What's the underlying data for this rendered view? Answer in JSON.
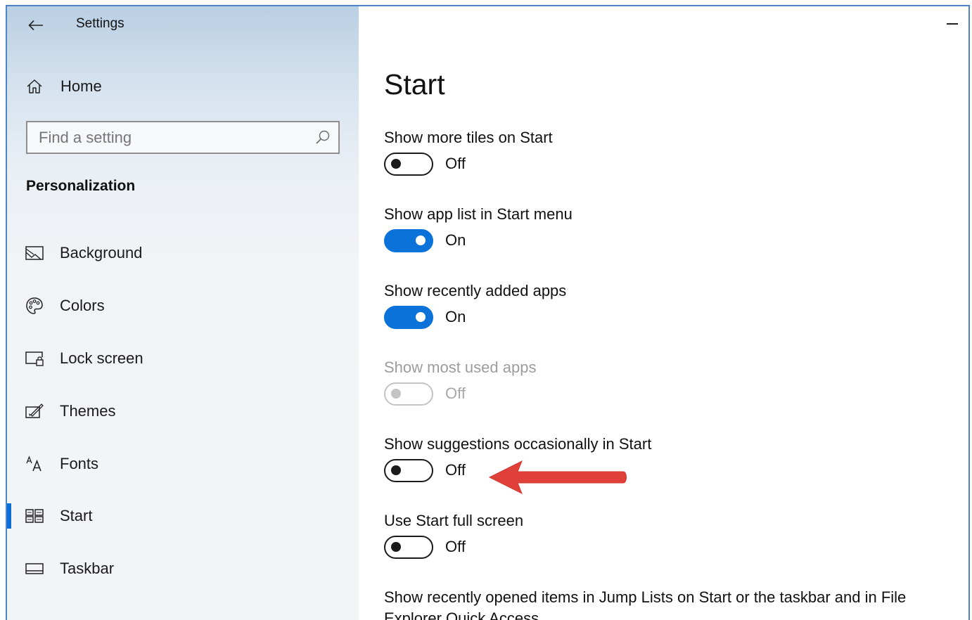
{
  "window": {
    "app_title": "Settings"
  },
  "sidebar": {
    "home_label": "Home",
    "search": {
      "placeholder": "Find a setting",
      "value": ""
    },
    "section_header": "Personalization",
    "items": [
      {
        "label": "Background",
        "icon": "image-icon",
        "selected": false
      },
      {
        "label": "Colors",
        "icon": "palette-icon",
        "selected": false
      },
      {
        "label": "Lock screen",
        "icon": "lock-screen-icon",
        "selected": false
      },
      {
        "label": "Themes",
        "icon": "themes-icon",
        "selected": false
      },
      {
        "label": "Fonts",
        "icon": "fonts-icon",
        "selected": false
      },
      {
        "label": "Start",
        "icon": "start-tiles-icon",
        "selected": true
      },
      {
        "label": "Taskbar",
        "icon": "taskbar-icon",
        "selected": false
      }
    ]
  },
  "main": {
    "title": "Start",
    "settings": [
      {
        "label": "Show more tiles on Start",
        "state": "Off",
        "on": false,
        "disabled": false
      },
      {
        "label": "Show app list in Start menu",
        "state": "On",
        "on": true,
        "disabled": false
      },
      {
        "label": "Show recently added apps",
        "state": "On",
        "on": true,
        "disabled": false
      },
      {
        "label": "Show most used apps",
        "state": "Off",
        "on": false,
        "disabled": true
      },
      {
        "label": "Show suggestions occasionally in Start",
        "state": "Off",
        "on": false,
        "disabled": false
      },
      {
        "label": "Use Start full screen",
        "state": "Off",
        "on": false,
        "disabled": false
      }
    ],
    "last_setting_label": "Show recently opened items in Jump Lists on Start or the taskbar and in File Explorer Quick Access"
  },
  "colors": {
    "accent": "#0a72d8",
    "annotation_arrow": "#e0403a",
    "window_border": "#4a86c8"
  }
}
